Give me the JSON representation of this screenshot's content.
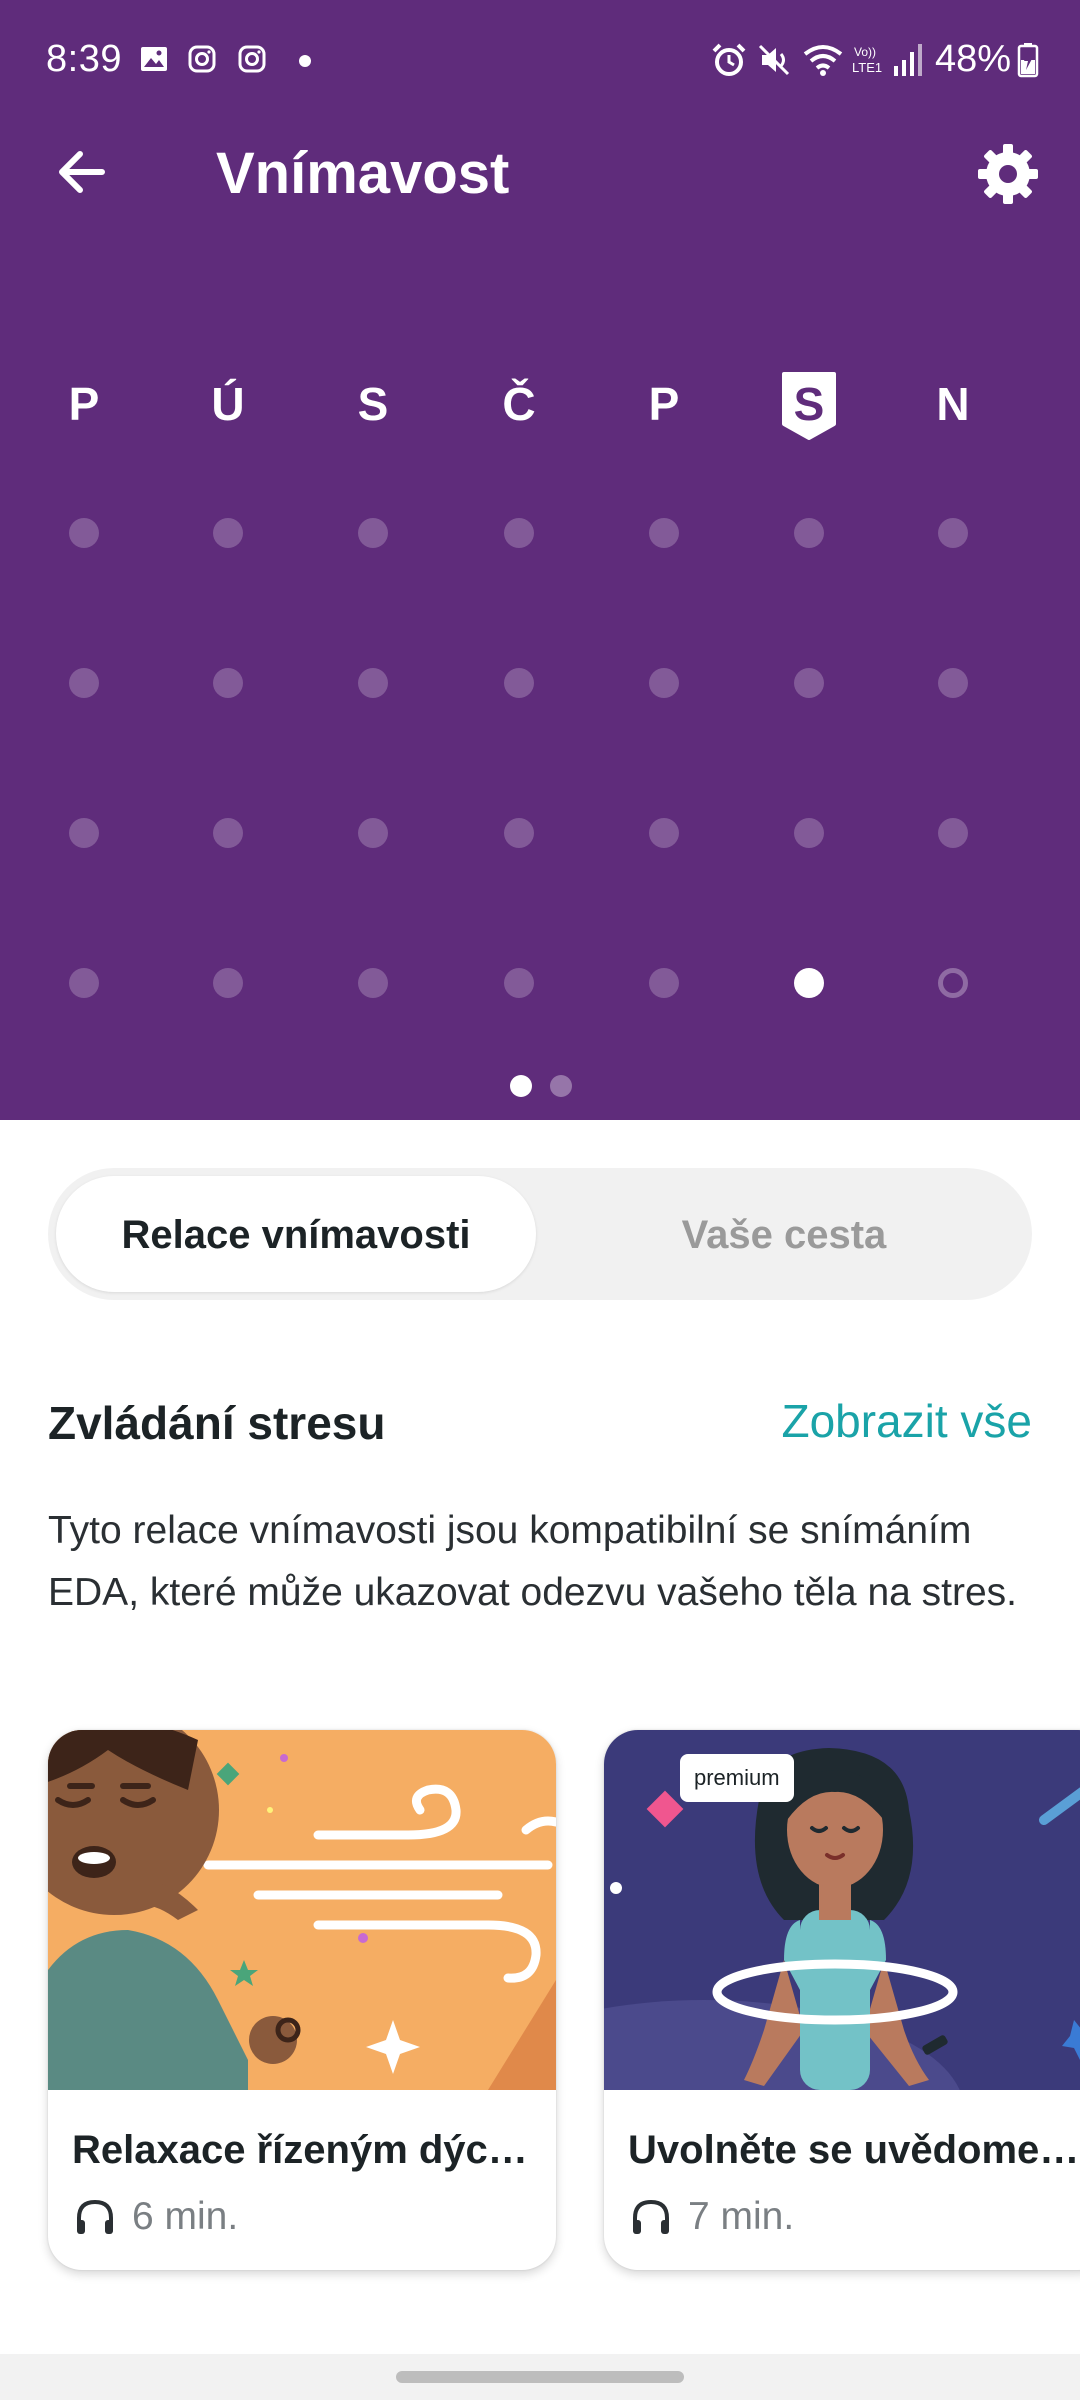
{
  "status_bar": {
    "time": "8:39",
    "battery": "48%",
    "network": "LTE1"
  },
  "app_bar": {
    "title": "Vnímavost",
    "back_icon": "arrow-left-icon",
    "settings_icon": "gear-icon"
  },
  "week": {
    "days": [
      "P",
      "Ú",
      "S",
      "Č",
      "P",
      "S",
      "N"
    ],
    "selected_day_index": 5,
    "rows": 4,
    "completed": [
      [
        3,
        5
      ]
    ],
    "today_marker": [
      [
        3,
        6
      ]
    ]
  },
  "pager": {
    "count": 2,
    "active": 0
  },
  "tabs": {
    "items": [
      {
        "label": "Relace vnímavosti",
        "active": true
      },
      {
        "label": "Vaše cesta",
        "active": false
      }
    ]
  },
  "section": {
    "title": "Zvládání stresu",
    "link": "Zobrazit vše",
    "description": "Tyto relace vnímavosti jsou kompatibilní se snímáním EDA, které může ukazovat odezvu vašeho těla na stres."
  },
  "cards": [
    {
      "title": "Relaxace řízeným dýc…",
      "duration": "6 min.",
      "premium": false
    },
    {
      "title": "Uvolněte se uvědomen…",
      "duration": "7 min.",
      "premium": true,
      "badge": "premium"
    }
  ],
  "colors": {
    "header": "#5f2c7b",
    "link": "#1aa3a8",
    "card1_bg": "#f5ad63",
    "card2_bg": "#3b3a7a"
  }
}
